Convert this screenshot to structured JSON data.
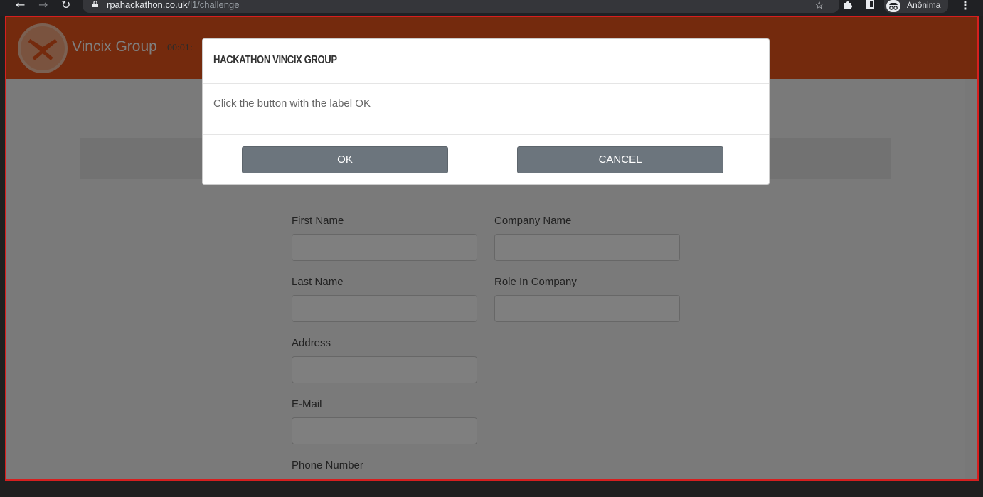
{
  "browser": {
    "url_host": "rpahackathon.co.uk",
    "url_path": "/l1/challenge",
    "profile_label": "Anônima"
  },
  "header": {
    "brand": "Vincix Group",
    "timer": "00:01:"
  },
  "form": {
    "first_name_label": "First Name",
    "last_name_label": "Last Name",
    "address_label": "Address",
    "email_label": "E-Mail",
    "phone_label": "Phone Number",
    "company_name_label": "Company Name",
    "role_label": "Role In Company"
  },
  "modal": {
    "title": "HACKATHON VINCIX GROUP",
    "body": "Click the button with the label OK",
    "ok_label": "OK",
    "cancel_label": "CANCEL"
  },
  "colors": {
    "header_bg": "#e8541b",
    "button_bg": "#6c757d",
    "highlight_border": "#d61f1f"
  },
  "icons": [
    "back-arrow-icon",
    "forward-arrow-icon",
    "reload-icon",
    "lock-icon",
    "star-icon",
    "extensions-icon",
    "side-panel-icon",
    "incognito-icon",
    "menu-dots-icon",
    "vincix-logo"
  ]
}
